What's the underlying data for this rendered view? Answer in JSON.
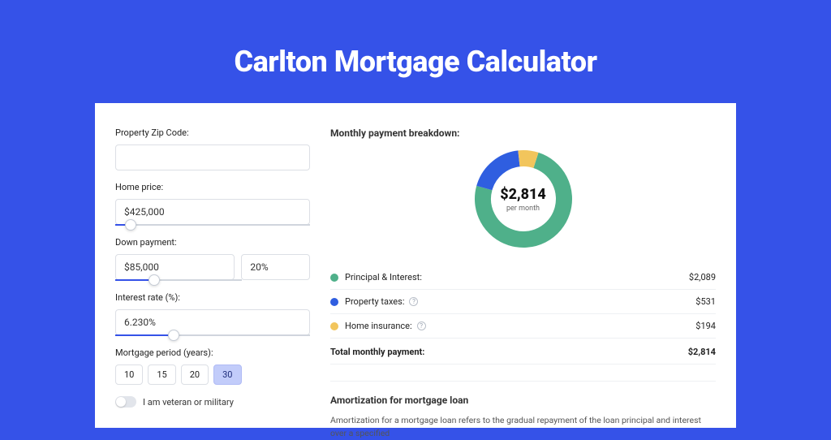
{
  "title": "Carlton Mortgage Calculator",
  "form": {
    "zip_label": "Property Zip Code:",
    "zip_value": "",
    "home_price_label": "Home price:",
    "home_price_value": "$425,000",
    "home_price_slider_pct": 8,
    "down_payment_label": "Down payment:",
    "down_payment_value": "$85,000",
    "down_payment_pct_value": "20%",
    "down_payment_slider_pct": 20,
    "interest_label": "Interest rate (%):",
    "interest_value": "6.230%",
    "interest_slider_pct": 30,
    "period_label": "Mortgage period (years):",
    "periods": [
      "10",
      "15",
      "20",
      "30"
    ],
    "period_selected": "30",
    "veteran_label": "I am veteran or military"
  },
  "breakdown": {
    "title": "Monthly payment breakdown:",
    "center_value": "$2,814",
    "center_sub": "per month",
    "rows": [
      {
        "label": "Principal & Interest:",
        "value": "$2,089",
        "color": "#4fb08a",
        "info": false
      },
      {
        "label": "Property taxes:",
        "value": "$531",
        "color": "#2f5ee0",
        "info": true
      },
      {
        "label": "Home insurance:",
        "value": "$194",
        "color": "#f2c55c",
        "info": true
      }
    ],
    "total_label": "Total monthly payment:",
    "total_value": "$2,814"
  },
  "chart_data": {
    "type": "pie",
    "title": "Monthly payment breakdown",
    "series": [
      {
        "name": "Principal & Interest",
        "value": 2089,
        "color": "#4fb08a"
      },
      {
        "name": "Property taxes",
        "value": 531,
        "color": "#2f5ee0"
      },
      {
        "name": "Home insurance",
        "value": 194,
        "color": "#f2c55c"
      }
    ],
    "total": 2814
  },
  "amortization": {
    "title": "Amortization for mortgage loan",
    "body": "Amortization for a mortgage loan refers to the gradual repayment of the loan principal and interest over a specified"
  }
}
